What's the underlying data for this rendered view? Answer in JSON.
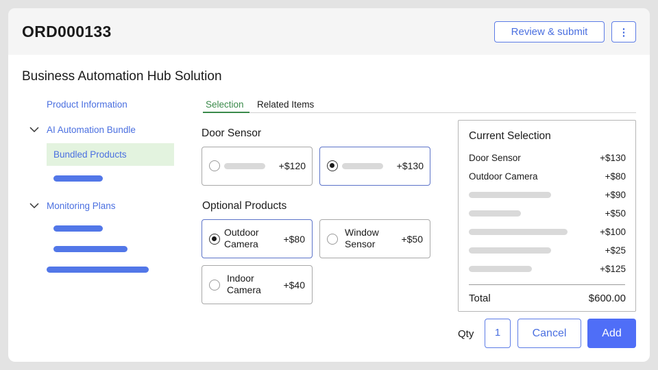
{
  "header": {
    "order_id": "ORD000133",
    "review_label": "Review & submit",
    "more_label": "⋮"
  },
  "solution_title": "Business Automation Hub Solution",
  "nav": {
    "product_information": "Product Information",
    "ai_bundle": "AI Automation Bundle",
    "bundled_products": "Bundled Products",
    "monitoring_plans": "Monitoring Plans"
  },
  "tabs": {
    "selection": "Selection",
    "related": "Related Items"
  },
  "door_sensor": {
    "title": "Door Sensor",
    "options": [
      {
        "price": "+$120",
        "selected": false
      },
      {
        "price": "+$130",
        "selected": true
      }
    ]
  },
  "optional_products": {
    "title": "Optional Products",
    "options": [
      {
        "label_line1": "Outdoor",
        "label_line2": "Camera",
        "price": "+$80",
        "selected": true
      },
      {
        "label_line1": "Window",
        "label_line2": "Sensor",
        "price": "+$50",
        "selected": false
      },
      {
        "label_line1": "Indoor",
        "label_line2": "Camera",
        "price": "+$40",
        "selected": false
      }
    ]
  },
  "summary": {
    "title": "Current Selection",
    "rows": [
      {
        "label": "Door Sensor",
        "price": "+$130"
      },
      {
        "label": "Outdoor Camera",
        "price": "+$80"
      },
      {
        "label": "",
        "price": "+$90"
      },
      {
        "label": "",
        "price": "+$50"
      },
      {
        "label": "",
        "price": "+$100"
      },
      {
        "label": "",
        "price": "+$25"
      },
      {
        "label": "",
        "price": "+$125"
      }
    ],
    "total_label": "Total",
    "total_value": "$600.00"
  },
  "footer": {
    "qty_label": "Qty",
    "qty_value": "1",
    "cancel_label": "Cancel",
    "add_label": "Add"
  },
  "colors": {
    "accent": "#4f6ef7",
    "link": "#4a6fe0",
    "selected_nav_bg": "#e3f3df",
    "active_tab": "#3a8a4a"
  }
}
